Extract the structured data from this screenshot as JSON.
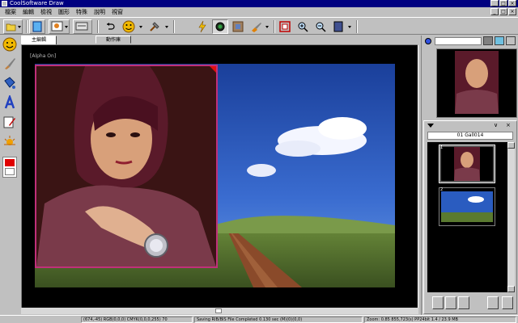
{
  "window": {
    "title": "CoolSoftware Draw",
    "controls": [
      "_",
      "□",
      "×"
    ]
  },
  "menubar": {
    "items": [
      "檔案",
      "編輯",
      "檢視",
      "圖形",
      "特殊",
      "說明",
      "視窗"
    ],
    "mdi_controls": [
      "_",
      "□",
      "×"
    ]
  },
  "tabs": [
    {
      "label": "主編輯",
      "active": true
    },
    {
      "label": "動作庫",
      "active": false
    }
  ],
  "document": {
    "alpha_label": "[Alpha On]"
  },
  "gallery": {
    "title": "01 Gall014",
    "header_buttons": [
      "∨",
      "×"
    ],
    "thumbnail_numbers": [
      "1",
      "2"
    ]
  },
  "statusbar": {
    "cells": [
      "(674,-45) RGB(0,0,0) CMYK(0,0,0,255) 70",
      "Saving RIB/BIS File Completed 0.130 sec (M)(0)(0,0)",
      "Zoom: 0.85  855,723(s) PP24bit  1.4 / 23.9 MB"
    ]
  },
  "colors": {
    "title_bar": "#000080",
    "chrome": "#c0c0c0",
    "selection_frame": "#c0307a",
    "canvas_bg": "#000000"
  }
}
